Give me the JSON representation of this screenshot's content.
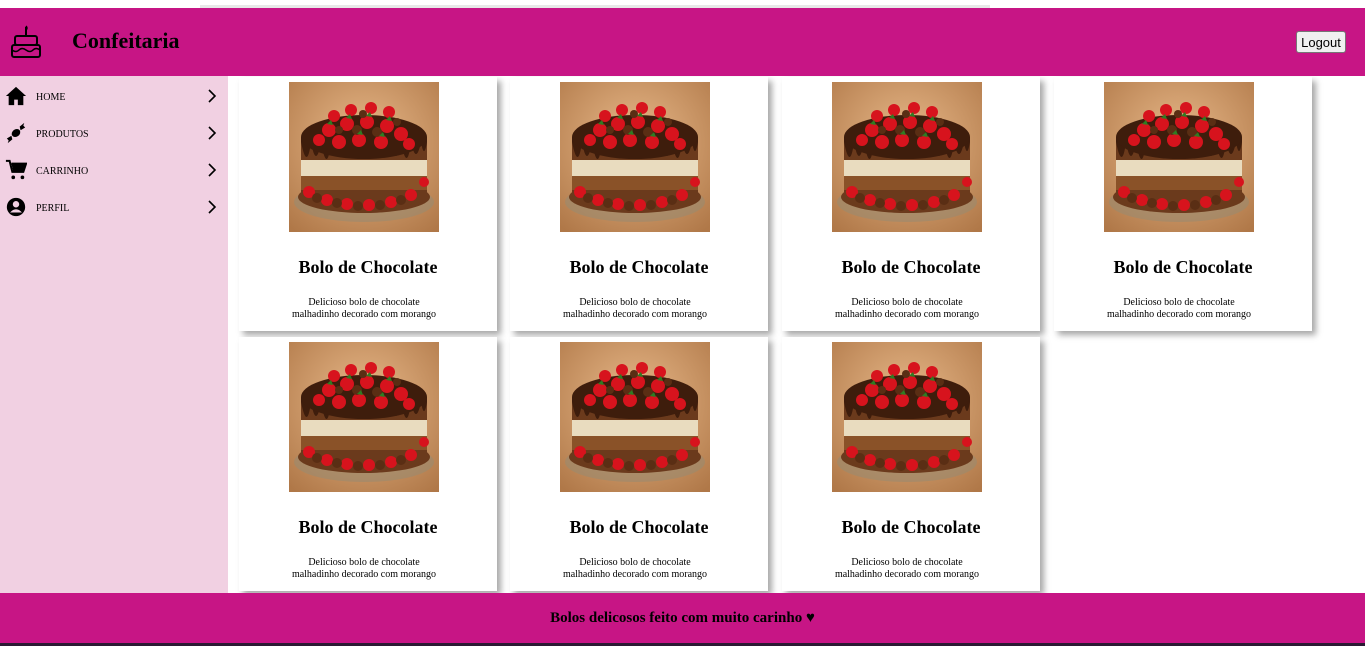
{
  "header": {
    "brand": "Confeitaria",
    "logout_label": "Logout",
    "logo_icon": "cake-icon",
    "background": "#c71585"
  },
  "sidebar": {
    "background": "#f1d0e2",
    "items": [
      {
        "label": "HOME",
        "icon": "home-icon"
      },
      {
        "label": "PRODUTOS",
        "icon": "candy-icon"
      },
      {
        "label": "CARRINHO",
        "icon": "cart-icon"
      },
      {
        "label": "PERFIL",
        "icon": "profile-icon"
      }
    ]
  },
  "products": [
    {
      "title": "Bolo de Chocolate",
      "description": "Delicioso bolo de chocolate malhadinho decorado com morango"
    },
    {
      "title": "Bolo de Chocolate",
      "description": "Delicioso bolo de chocolate malhadinho decorado com morango"
    },
    {
      "title": "Bolo de Chocolate",
      "description": "Delicioso bolo de chocolate malhadinho decorado com morango"
    },
    {
      "title": "Bolo de Chocolate",
      "description": "Delicioso bolo de chocolate malhadinho decorado com morango"
    },
    {
      "title": "Bolo de Chocolate",
      "description": "Delicioso bolo de chocolate malhadinho decorado com morango"
    },
    {
      "title": "Bolo de Chocolate",
      "description": "Delicioso bolo de chocolate malhadinho decorado com morango"
    },
    {
      "title": "Bolo de Chocolate",
      "description": "Delicioso bolo de chocolate malhadinho decorado com morango"
    }
  ],
  "footer": {
    "text": "Bolos delicosos feito com muito carinho ♥"
  }
}
